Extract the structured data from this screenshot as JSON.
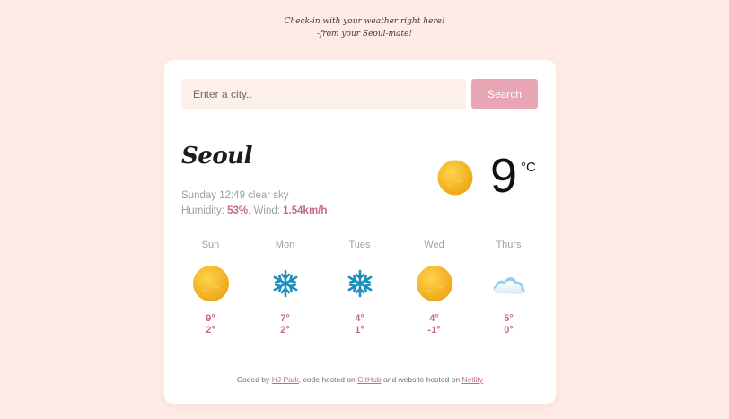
{
  "header": {
    "tagline_line1": "Check-in with your weather right here!",
    "tagline_line2": "-from your Seoul-mate!"
  },
  "search": {
    "placeholder": "Enter a city..",
    "button_label": "Search"
  },
  "current": {
    "city": "Seoul",
    "datetime_desc": "Sunday 12:49 clear sky",
    "humidity_label": "Humidity:",
    "humidity_value": "53%",
    "wind_label": ", Wind:",
    "wind_value": "1.54km/h",
    "temperature": "9",
    "unit": "°C",
    "icon": "sun-icon"
  },
  "forecast": [
    {
      "day": "Sun",
      "icon": "sun-icon",
      "max": "9°",
      "min": "2°"
    },
    {
      "day": "Mon",
      "icon": "snowflake-icon",
      "max": "7°",
      "min": "2°"
    },
    {
      "day": "Tues",
      "icon": "snowflake-icon",
      "max": "4°",
      "min": "1°"
    },
    {
      "day": "Wed",
      "icon": "sun-icon",
      "max": "4°",
      "min": "-1°"
    },
    {
      "day": "Thurs",
      "icon": "cloud-icon",
      "max": "5°",
      "min": "0°"
    }
  ],
  "footer": {
    "coded_by": "Coded by",
    "author": "HJ Park",
    "code_hosted": ", code hosted on",
    "github": "GitHub",
    "website_hosted": "and website hosted on",
    "netlify": "Netlify"
  },
  "colors": {
    "background": "#ffebe6",
    "accent": "#c96a80",
    "button": "#e8a5b4",
    "sun": "#f2b41c"
  }
}
